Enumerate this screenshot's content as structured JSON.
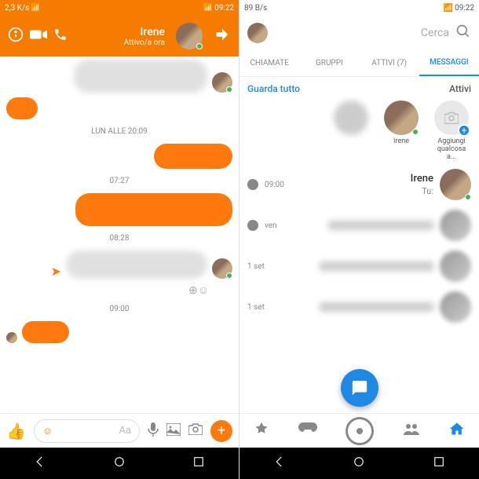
{
  "left": {
    "status": {
      "speed": "2,3 K/s",
      "time": "09:22"
    },
    "header": {
      "name": "Irene",
      "status_text": "Attivo/a ora"
    },
    "timestamps": {
      "t1": "LUN ALLE 20:09",
      "t2": "07:27",
      "t3": "08:28",
      "t4": "09:00"
    },
    "input": {
      "placeholder": "Aa"
    }
  },
  "right": {
    "status": {
      "speed": "89 B/s",
      "time": "09:22"
    },
    "search": {
      "placeholder": "Cerca"
    },
    "tabs": {
      "chiamate": "CHIAMATE",
      "gruppi": "GRUPPI",
      "attivi": "ATTIVI (7)",
      "messaggi": "MESSAGGI"
    },
    "active": {
      "title": "Attivi",
      "link": "Guarda tutto",
      "add_label": "Aggiungi qualcosa a...",
      "irene": "Irene"
    },
    "convos": [
      {
        "name": "Irene",
        "preview": "Tu:",
        "time": "09:00"
      },
      {
        "time": "ven"
      },
      {
        "time": "1 set"
      },
      {
        "time": "1 set"
      }
    ]
  }
}
